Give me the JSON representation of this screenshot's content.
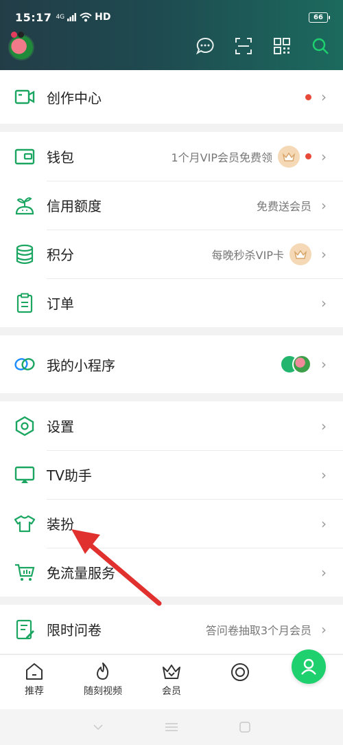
{
  "status_bar": {
    "time": "15:17",
    "network": "4G",
    "hd": "HD",
    "battery": "66"
  },
  "header": {
    "icons": [
      "message-icon",
      "scan-icon",
      "qrcode-icon",
      "search-icon"
    ]
  },
  "menu_groups": [
    {
      "items": [
        {
          "icon": "video-camera-icon",
          "label": "创作中心",
          "dot": true
        }
      ]
    },
    {
      "items": [
        {
          "icon": "wallet-icon",
          "label": "钱包",
          "hint": "1个月VIP会员免费领",
          "crown": true,
          "dot": true
        },
        {
          "icon": "sprout-icon",
          "label": "信用额度",
          "hint": "免费送会员"
        },
        {
          "icon": "coins-icon",
          "label": "积分",
          "hint": "每晚秒杀VIP卡",
          "crown": true
        },
        {
          "icon": "clipboard-icon",
          "label": "订单"
        }
      ]
    },
    {
      "items": [
        {
          "icon": "link-icon",
          "label": "我的小程序",
          "mini_apps": true
        }
      ]
    },
    {
      "items": [
        {
          "icon": "settings-hex-icon",
          "label": "设置"
        },
        {
          "icon": "tv-icon",
          "label": "TV助手"
        },
        {
          "icon": "tshirt-icon",
          "label": "装扮"
        },
        {
          "icon": "cart-icon",
          "label": "免流量服务"
        }
      ]
    },
    {
      "items": [
        {
          "icon": "survey-icon",
          "label": "限时问卷",
          "hint": "答问卷抽取3个月会员"
        }
      ]
    }
  ],
  "bottom_nav": [
    {
      "icon": "home-icon",
      "label": "推荐"
    },
    {
      "icon": "flame-icon",
      "label": "随刻视频"
    },
    {
      "icon": "crown-outline-icon",
      "label": "会员"
    },
    {
      "icon": "circle-target-icon",
      "label": ""
    },
    {
      "icon": "user-icon",
      "label": ""
    }
  ],
  "colors": {
    "accent": "#1ed06e",
    "icon_green": "#1aa661",
    "dot_red": "#e84a3a",
    "header_dark": "#233d47",
    "arrow": "#e0312f"
  }
}
